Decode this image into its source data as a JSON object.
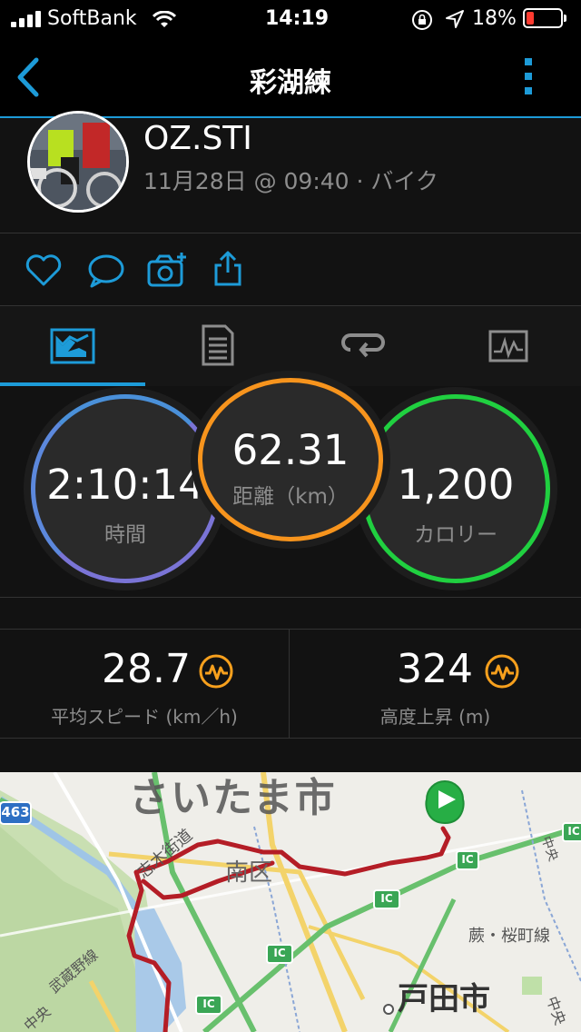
{
  "status_bar": {
    "carrier": "SoftBank",
    "time": "14:19",
    "battery": "18%"
  },
  "header": {
    "title": "彩湖練",
    "back_icon": "chevron-left-icon",
    "more_icon": "vertical-dots-icon",
    "accent": "#1d9bd8"
  },
  "activity": {
    "user": "OZ.STI",
    "meta": "11月28日 @ 09:40 · バイク"
  },
  "actions": [
    "heart-icon",
    "comment-icon",
    "camera-add-icon",
    "share-icon"
  ],
  "tabs": [
    "overview-icon",
    "details-icon",
    "laps-icon",
    "chart-icon"
  ],
  "stats": {
    "time": {
      "value": "2:10:14",
      "label": "時間"
    },
    "distance": {
      "value": "62.31",
      "label": "距離（km）"
    },
    "calories": {
      "value": "1,200",
      "label": "カロリー"
    }
  },
  "summary": {
    "avg_speed": {
      "value": "28.7",
      "label": "平均スピード (km／h)"
    },
    "elevation": {
      "value": "324",
      "label": "高度上昇 (m)"
    }
  },
  "map": {
    "city": "さいたま市",
    "district": "南区",
    "city2": "戸田市",
    "road1": "志木街道",
    "road2": "武蔵野線",
    "road3": "蕨・桜町線",
    "road4": "中央",
    "route_no": "463",
    "ic": "IC"
  }
}
